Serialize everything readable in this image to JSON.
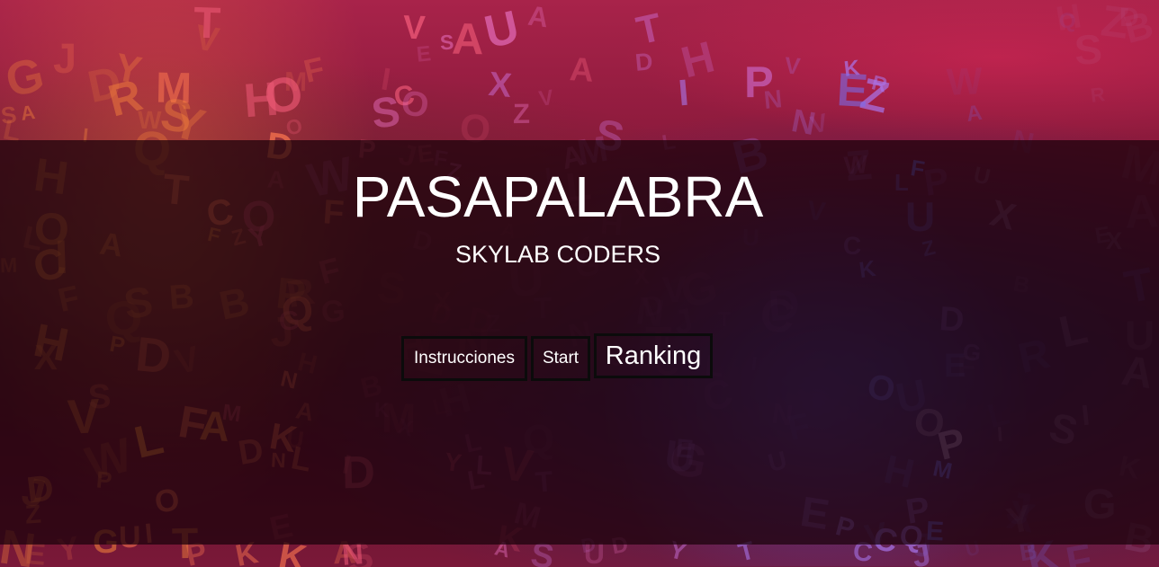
{
  "app": {
    "title": "PASAPALABRA",
    "subtitle": "SKYLAB CODERS"
  },
  "buttons": {
    "instructions_label": "Instrucciones",
    "start_label": "Start",
    "ranking_label": "Ranking"
  },
  "colors": {
    "background_top": "#a8234a",
    "background_bottom": "#5a1028",
    "overlay": "#19020a",
    "text": "#ffffff",
    "button_border": "#0b0b0b"
  }
}
